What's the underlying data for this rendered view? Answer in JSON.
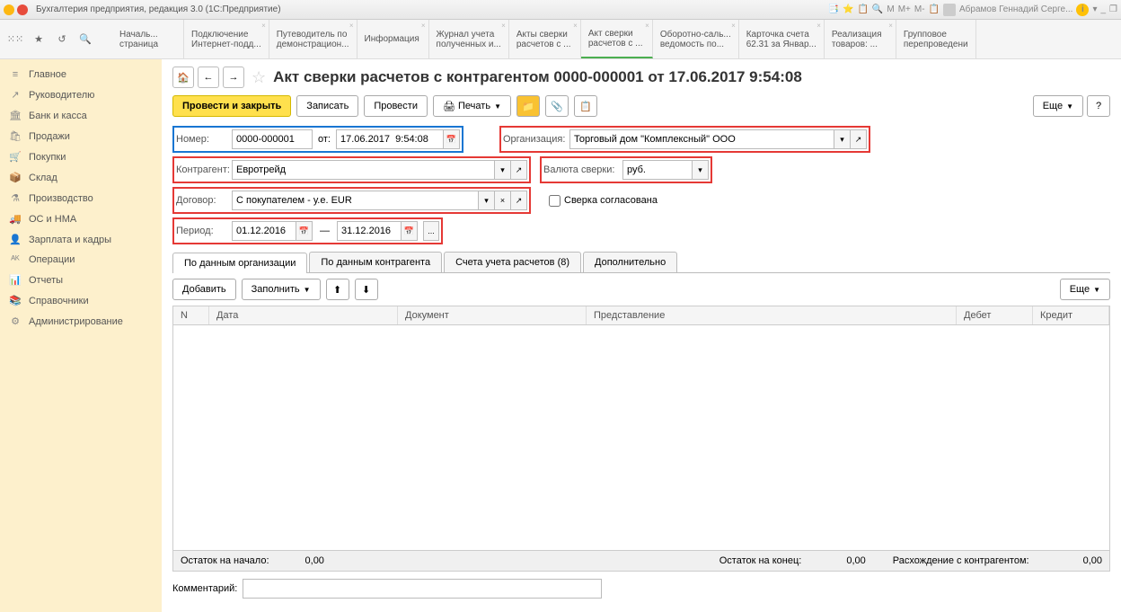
{
  "titlebar": {
    "app_title": "Бухгалтерия предприятия, редакция 3.0  (1С:Предприятие)",
    "user": "Абрамов Геннадий Серге..."
  },
  "top_tabs": [
    {
      "l1": "Началь...",
      "l2": "страница"
    },
    {
      "l1": "Подключение",
      "l2": "Интернет-подд..."
    },
    {
      "l1": "Путеводитель по",
      "l2": "демонстрацион..."
    },
    {
      "l1": "Информация",
      "l2": ""
    },
    {
      "l1": "Журнал учета",
      "l2": "полученных и..."
    },
    {
      "l1": "Акты сверки",
      "l2": "расчетов с ..."
    },
    {
      "l1": "Акт сверки",
      "l2": "расчетов с ..."
    },
    {
      "l1": "Оборотно-саль...",
      "l2": "ведомость по..."
    },
    {
      "l1": "Карточка счета",
      "l2": "62.31 за Январ..."
    },
    {
      "l1": "Реализация",
      "l2": "товаров: ..."
    },
    {
      "l1": "Групповое",
      "l2": "перепроведени"
    }
  ],
  "sidebar": {
    "items": [
      {
        "icon": "≡",
        "label": "Главное"
      },
      {
        "icon": "↗",
        "label": "Руководителю"
      },
      {
        "icon": "🏛",
        "label": "Банк и касса"
      },
      {
        "icon": "🛍",
        "label": "Продажи"
      },
      {
        "icon": "🛒",
        "label": "Покупки"
      },
      {
        "icon": "📦",
        "label": "Склад"
      },
      {
        "icon": "⚗",
        "label": "Производство"
      },
      {
        "icon": "🚚",
        "label": "ОС и НМА"
      },
      {
        "icon": "👤",
        "label": "Зарплата и кадры"
      },
      {
        "icon": "ᴬᴷ",
        "label": "Операции"
      },
      {
        "icon": "📊",
        "label": "Отчеты"
      },
      {
        "icon": "📚",
        "label": "Справочники"
      },
      {
        "icon": "⚙",
        "label": "Администрирование"
      }
    ]
  },
  "page": {
    "title": "Акт сверки расчетов с контрагентом 0000-000001 от 17.06.2017 9:54:08"
  },
  "toolbar": {
    "post_close": "Провести и закрыть",
    "save": "Записать",
    "post": "Провести",
    "print": "Печать",
    "more": "Еще"
  },
  "form": {
    "number_label": "Номер:",
    "number": "0000-000001",
    "from_label": "от:",
    "date": "17.06.2017  9:54:08",
    "org_label": "Организация:",
    "org": "Торговый дом \"Комплексный\" ООО",
    "partner_label": "Контрагент:",
    "partner": "Евротрейд",
    "currency_label": "Валюта сверки:",
    "currency": "руб.",
    "contract_label": "Договор:",
    "contract": "С покупателем - у.е. EUR",
    "agreed_label": "Сверка согласована",
    "period_label": "Период:",
    "period_from": "01.12.2016",
    "period_dash": "—",
    "period_to": "31.12.2016"
  },
  "tabs": {
    "t1": "По данным организации",
    "t2": "По данным контрагента",
    "t3": "Счета учета расчетов (8)",
    "t4": "Дополнительно"
  },
  "table_toolbar": {
    "add": "Добавить",
    "fill": "Заполнить",
    "more": "Еще"
  },
  "grid": {
    "cols": {
      "n": "N",
      "date": "Дата",
      "doc": "Документ",
      "repr": "Представление",
      "debit": "Дебет",
      "credit": "Кредит"
    }
  },
  "footer": {
    "start_label": "Остаток на начало:",
    "start_val": "0,00",
    "end_label": "Остаток на конец:",
    "end_val": "0,00",
    "diff_label": "Расхождение с контрагентом:",
    "diff_val": "0,00"
  },
  "comment": {
    "label": "Комментарий:"
  }
}
